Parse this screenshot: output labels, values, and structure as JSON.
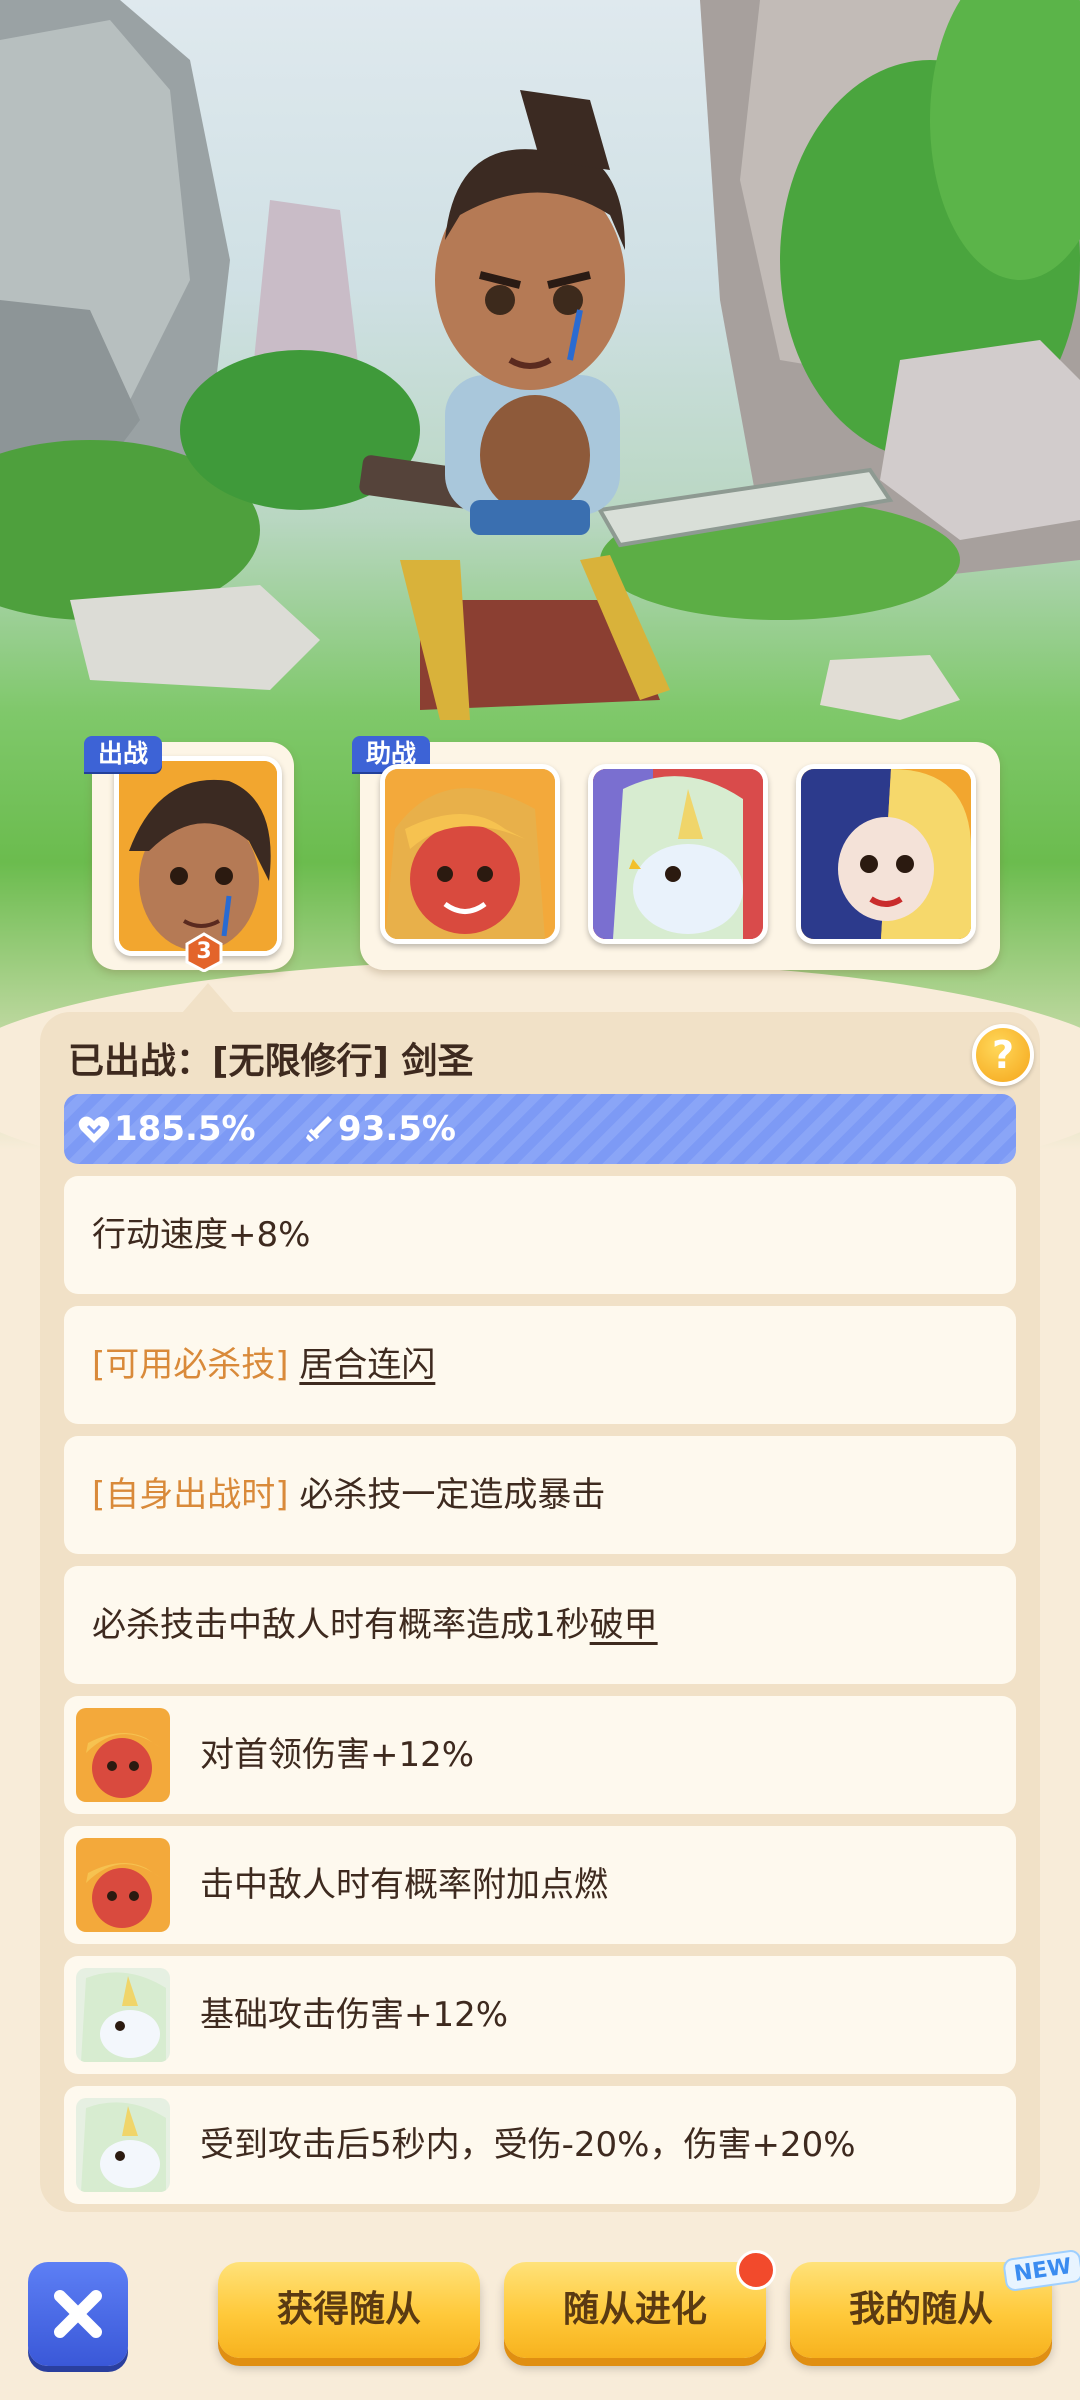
{
  "team": {
    "main_tag": "出战",
    "support_tag": "助战",
    "main_level": "3"
  },
  "panel": {
    "title": "已出战：[无限修行] 剑圣",
    "help_icon": "?",
    "stats": {
      "hp": "185.5%",
      "attack": "93.5%"
    },
    "traits": [
      {
        "text": "行动速度+8%"
      },
      {
        "tag": "[可用必杀技]",
        "text": "居合连闪"
      },
      {
        "tag": "[自身出战时]",
        "text": "必杀技一定造成暴击"
      },
      {
        "prefix": "必杀技击中敌人时有概率造成1秒",
        "link": "破甲"
      },
      {
        "icon": "fire-girl-portrait",
        "text": "对首领伤害+12%"
      },
      {
        "icon": "fire-girl-portrait",
        "text": "击中敌人时有概率附加点燃"
      },
      {
        "icon": "unicorn-portrait",
        "text": "基础攻击伤害+12%"
      },
      {
        "icon": "unicorn-portrait",
        "text": "受到攻击后5秒内，受伤-20%，伤害+20%"
      }
    ]
  },
  "bottom": {
    "get_label": "获得随从",
    "evolve_label": "随从进化",
    "mine_label": "我的随从",
    "new_badge": "NEW"
  },
  "colors": {
    "accent_blue": "#3d63d6",
    "button_yellow": "#ffc93a",
    "tag_orange": "#d98a3a"
  }
}
